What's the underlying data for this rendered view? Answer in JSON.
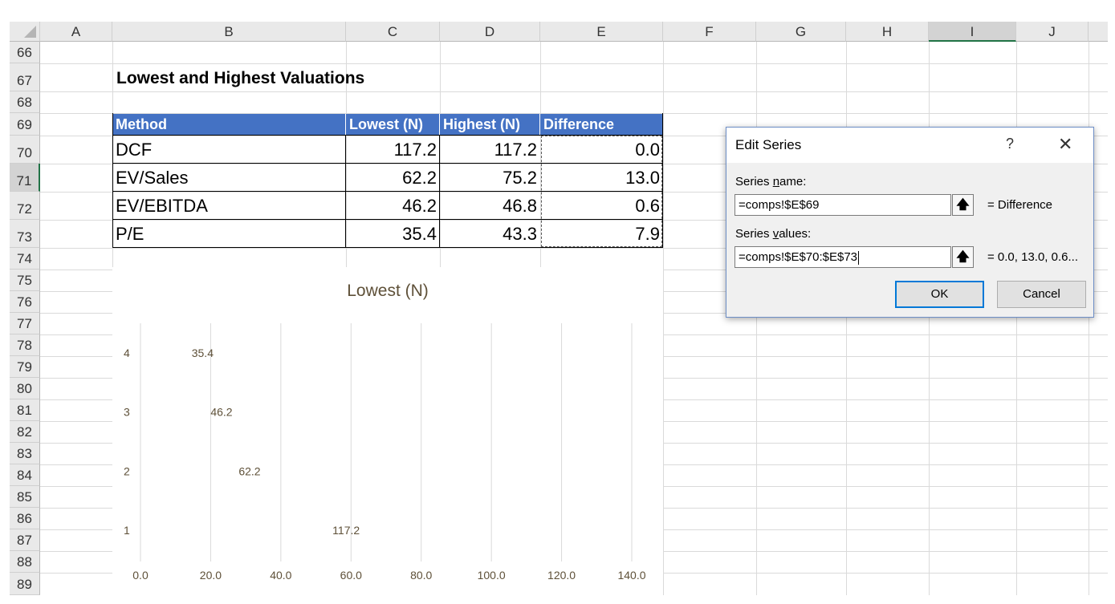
{
  "columns": [
    "A",
    "B",
    "C",
    "D",
    "E",
    "F",
    "G",
    "H",
    "I",
    "J"
  ],
  "selected_column": "I",
  "rows": [
    "66",
    "67",
    "68",
    "69",
    "70",
    "71",
    "72",
    "73",
    "74",
    "75",
    "76",
    "77",
    "78",
    "79",
    "80",
    "81",
    "82",
    "83",
    "84",
    "85",
    "86",
    "87",
    "88",
    "89"
  ],
  "selected_row": "71",
  "table": {
    "title": "Lowest and Highest Valuations",
    "headers": [
      "Method",
      "Lowest (N)",
      "Highest (N)",
      "Difference"
    ],
    "rows": [
      {
        "method": "DCF",
        "lowest": "117.2",
        "highest": "117.2",
        "difference": "0.0"
      },
      {
        "method": "EV/Sales",
        "lowest": "62.2",
        "highest": "75.2",
        "difference": "13.0"
      },
      {
        "method": "EV/EBITDA",
        "lowest": "46.2",
        "highest": "46.8",
        "difference": "0.6"
      },
      {
        "method": "P/E",
        "lowest": "35.4",
        "highest": "43.3",
        "difference": "7.9"
      }
    ]
  },
  "chart_data": {
    "type": "bar",
    "orientation": "horizontal",
    "title": "Lowest (N)",
    "categories": [
      "1",
      "2",
      "3",
      "4"
    ],
    "values": [
      117.2,
      62.2,
      46.2,
      35.4
    ],
    "data_labels": [
      "117.2",
      "62.2",
      "46.2",
      "35.4"
    ],
    "x_ticks": [
      "0.0",
      "20.0",
      "40.0",
      "60.0",
      "80.0",
      "100.0",
      "120.0",
      "140.0"
    ],
    "xlim": [
      0,
      140
    ],
    "grid": "vertical",
    "colors": {
      "text": "#5e5038",
      "grid": "#d9d9d9"
    }
  },
  "dialog": {
    "title": "Edit Series",
    "help": "?",
    "close": "✕",
    "series_name_label": "Series name:",
    "series_name_value": "=comps!$E$69",
    "series_name_result": "= Difference",
    "series_values_label": "Series values:",
    "series_values_value": "=comps!$E$70:$E$73",
    "series_values_result": "= 0.0, 13.0, 0.6...",
    "ok": "OK",
    "cancel": "Cancel",
    "collapse_icon": "collapse-dialog-icon"
  },
  "colors": {
    "table_header": "#4472c4",
    "excel_green": "#217346",
    "dialog_border": "#6d8ec6",
    "ok_border": "#0078d7"
  }
}
